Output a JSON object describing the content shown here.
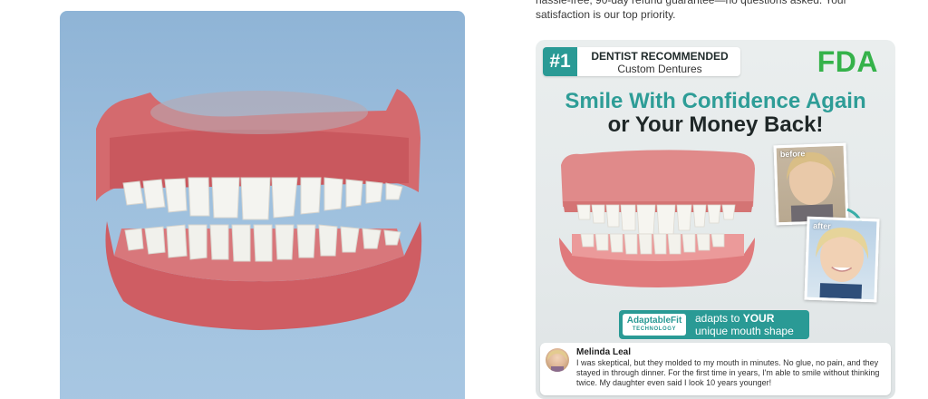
{
  "intro": {
    "line1": "hassle-free, 90-day refund guarantee—no questions asked. Your",
    "line2": "satisfaction is our top priority."
  },
  "ad": {
    "badge_number": "#1",
    "badge_line1": "DENTIST RECOMMENDED",
    "badge_line2": "Custom Dentures",
    "fda": "FDA",
    "headline_line1": "Smile With Confidence Again",
    "headline_line2": "or Your Money Back!",
    "before_label": "before",
    "after_label": "after",
    "tech_logo_line1": "AdaptableFit",
    "tech_logo_line2": "TECHNOLOGY",
    "tech_text_prefix": "adapts to ",
    "tech_text_emphasis": "YOUR",
    "tech_text_line2": "unique mouth shape",
    "testimonial_name": "Melinda Leal",
    "testimonial_text": "I was skeptical, but they molded to my mouth in minutes. No glue, no pain, and they stayed in through dinner. For the first time in years, I'm able to smile without thinking twice. My daughter even said I look 10 years younger!"
  },
  "colors": {
    "accent_teal": "#2a9a95",
    "fda_green": "#35b24a",
    "left_background": "#9ec0de"
  }
}
